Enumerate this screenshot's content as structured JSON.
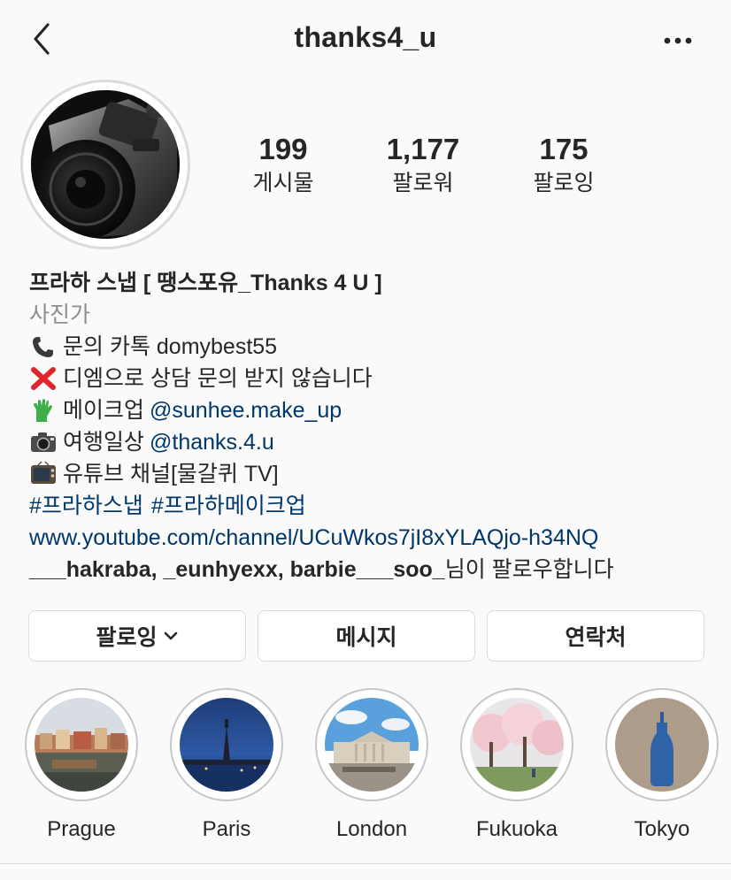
{
  "header": {
    "username": "thanks4_u",
    "back_icon": "chevron-left-icon",
    "more_icon": "more-horizontal-icon"
  },
  "profile": {
    "avatar_desc": "camera",
    "stats": [
      {
        "value": "199",
        "label": "게시물"
      },
      {
        "value": "1,177",
        "label": "팔로워"
      },
      {
        "value": "175",
        "label": "팔로잉"
      }
    ]
  },
  "bio": {
    "name": "프라하 스냅 [ 땡스포유_Thanks 4 U ]",
    "category": "사진가",
    "line1": "문의 카톡 domybest55",
    "line2": "디엠으로 상담 문의 받지 않습니다",
    "line3_text": "메이크업 ",
    "line3_link": "@sunhee.make_up",
    "line4_text": "여행일상 ",
    "line4_link": "@thanks.4.u",
    "line5": "유튜브 채널[물갈퀴 TV]",
    "hashtag1": "#프라하스냅",
    "hashtag2": "#프라하메이크업",
    "website": "www.youtube.com/channel/UCuWkos7jI8xYLAQjo-h34NQ",
    "followed_by_users": "___hakraba, _eunhyexx, barbie___soo_",
    "followed_by_suffix": "님이 팔로우합니다"
  },
  "actions": {
    "following": "팔로잉",
    "message": "메시지",
    "contact": "연락처"
  },
  "highlights": [
    {
      "label": "Prague"
    },
    {
      "label": "Paris"
    },
    {
      "label": "London"
    },
    {
      "label": "Fukuoka"
    },
    {
      "label": "Tokyo"
    }
  ],
  "colors": {
    "link": "#00376b",
    "text": "#262626",
    "secondary": "#8e8e8e",
    "border": "#dbdbdb",
    "background": "#fafafa"
  }
}
